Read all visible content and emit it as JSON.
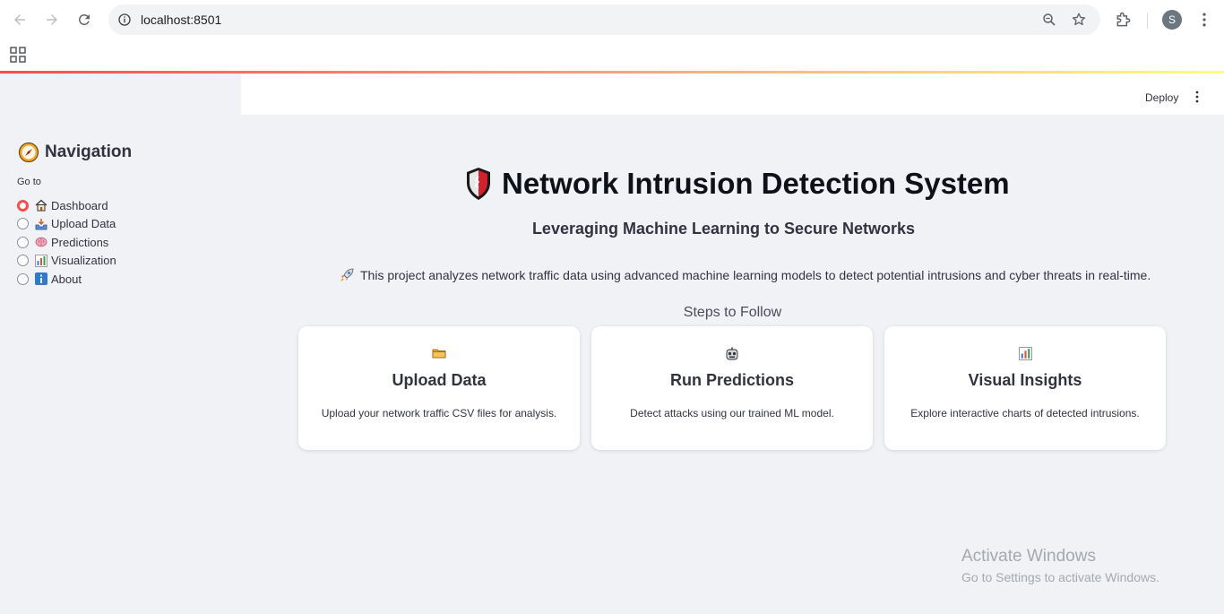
{
  "browser": {
    "url": "localhost:8501",
    "avatar_letter": "S"
  },
  "app_header": {
    "deploy_label": "Deploy"
  },
  "sidebar": {
    "title": "Navigation",
    "radio_label": "Go to",
    "items": [
      {
        "label": "Dashboard",
        "icon": "house-icon",
        "selected": true
      },
      {
        "label": "Upload Data",
        "icon": "inbox-tray-icon",
        "selected": false
      },
      {
        "label": "Predictions",
        "icon": "brain-icon",
        "selected": false
      },
      {
        "label": "Visualization",
        "icon": "bar-chart-icon",
        "selected": false
      },
      {
        "label": "About",
        "icon": "info-icon",
        "selected": false
      }
    ]
  },
  "main": {
    "title": "Network Intrusion Detection System",
    "subtitle": "Leveraging Machine Learning to Secure Networks",
    "description": "This project analyzes network traffic data using advanced machine learning models to detect potential intrusions and cyber threats in real-time.",
    "steps_heading": "Steps to Follow",
    "cards": [
      {
        "icon": "folder-icon",
        "title": "Upload Data",
        "desc": "Upload your network traffic CSV files for analysis."
      },
      {
        "icon": "robot-icon",
        "title": "Run Predictions",
        "desc": "Detect attacks using our trained ML model."
      },
      {
        "icon": "bar-chart-icon",
        "title": "Visual Insights",
        "desc": "Explore interactive charts of detected intrusions."
      }
    ]
  },
  "watermark": {
    "line1": "Activate Windows",
    "line2": "Go to Settings to activate Windows."
  },
  "colors": {
    "accent": "#ff4b4b",
    "sidebar_bg": "#f0f2f6"
  }
}
